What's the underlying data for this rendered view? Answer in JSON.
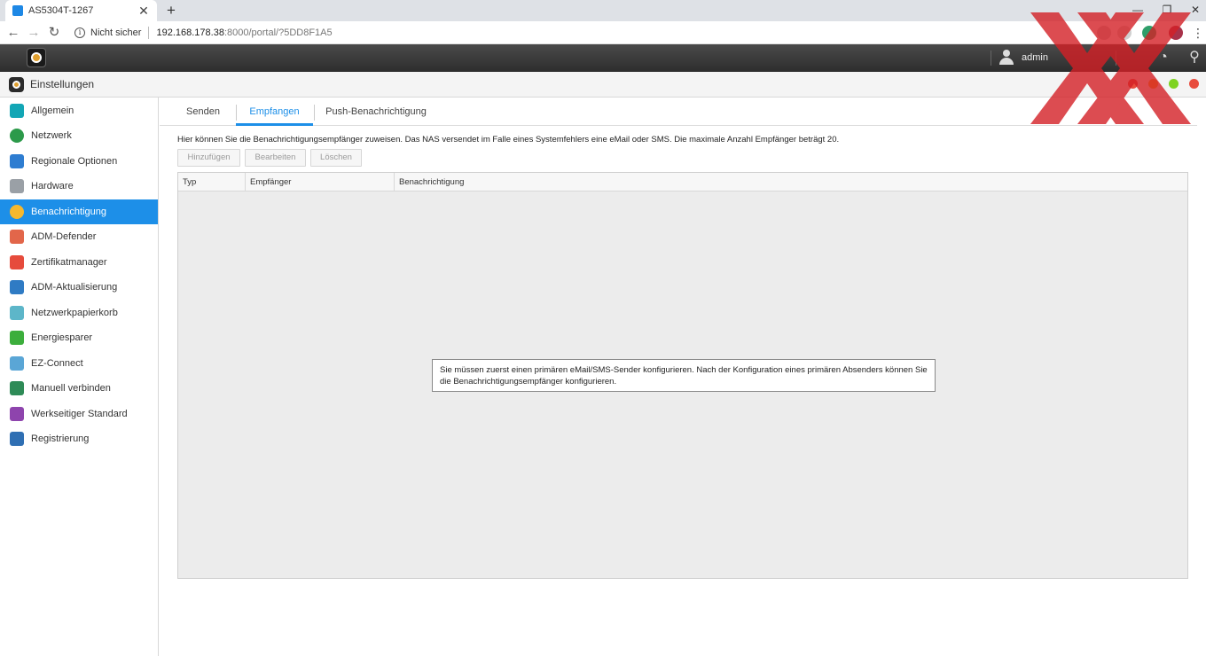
{
  "browser": {
    "tab_title": "AS5304T-1267",
    "tab_close": "✕",
    "new_tab": "+",
    "window_controls": [
      "—",
      "❐",
      "✕"
    ],
    "nav": [
      "←",
      "→",
      "↻"
    ],
    "security_label": "Nicht sicher",
    "url_host": "192.168.178.38",
    "url_rest": ":8000/portal/?5DD8F1A5",
    "menu": "⋮"
  },
  "adm": {
    "username": "admin",
    "colors": {
      "bar": "#3a3a3a",
      "accent": "#e0a030"
    }
  },
  "window": {
    "title": "Einstellungen",
    "dots": [
      "#e84c3d",
      "#f5a623",
      "#7ed321",
      "#e84c3d"
    ]
  },
  "sidebar": {
    "items": [
      {
        "label": "Allgemein",
        "icon": "general-icon",
        "color": "#12a6b5"
      },
      {
        "label": "Netzwerk",
        "icon": "network-globe-icon",
        "color": "#2c9a4a"
      },
      {
        "label": "Regionale Optionen",
        "icon": "regional-options-icon",
        "color": "#2e7dd1"
      },
      {
        "label": "Hardware",
        "icon": "hardware-icon",
        "color": "#9aa0a6"
      },
      {
        "label": "Benachrichtigung",
        "icon": "notification-icon",
        "color": "#f5b82e",
        "active": true
      },
      {
        "label": "ADM-Defender",
        "icon": "defender-icon",
        "color": "#e2664a"
      },
      {
        "label": "Zertifikatmanager",
        "icon": "certificate-icon",
        "color": "#e64b3c"
      },
      {
        "label": "ADM-Aktualisierung",
        "icon": "update-icon",
        "color": "#2f7bc4"
      },
      {
        "label": "Netzwerkpapierkorb",
        "icon": "recycle-bin-icon",
        "color": "#5db6c9"
      },
      {
        "label": "Energiesparer",
        "icon": "energy-saver-icon",
        "color": "#3cae3c"
      },
      {
        "label": "EZ-Connect",
        "icon": "ez-connect-cloud-icon",
        "color": "#5aa6d6"
      },
      {
        "label": "Manuell verbinden",
        "icon": "manual-connect-icon",
        "color": "#2e8b57"
      },
      {
        "label": "Werkseitiger Standard",
        "icon": "factory-default-icon",
        "color": "#8e44ad"
      },
      {
        "label": "Registrierung",
        "icon": "registration-icon",
        "color": "#2f6fb3"
      }
    ]
  },
  "tabs": [
    {
      "label": "Senden",
      "active": false
    },
    {
      "label": "Empfangen",
      "active": true
    },
    {
      "label": "Push-Benachrichtigung",
      "active": false
    }
  ],
  "description": "Hier können Sie die Benachrichtigungsempfänger zuweisen. Das NAS versendet im Falle eines Systemfehlers eine eMail oder SMS. Die maximale Anzahl Empfänger beträgt 20.",
  "buttons": {
    "add": "Hinzufügen",
    "edit": "Bearbeiten",
    "delete": "Löschen"
  },
  "table": {
    "columns": [
      "Typ",
      "Empfänger",
      "Benachrichtigung"
    ],
    "rows": []
  },
  "notice": "Sie müssen zuerst einen primären eMail/SMS-Sender konfigurieren. Nach der Konfiguration eines primären Absenders können Sie die Benachrichtigungsempfänger konfigurieren."
}
